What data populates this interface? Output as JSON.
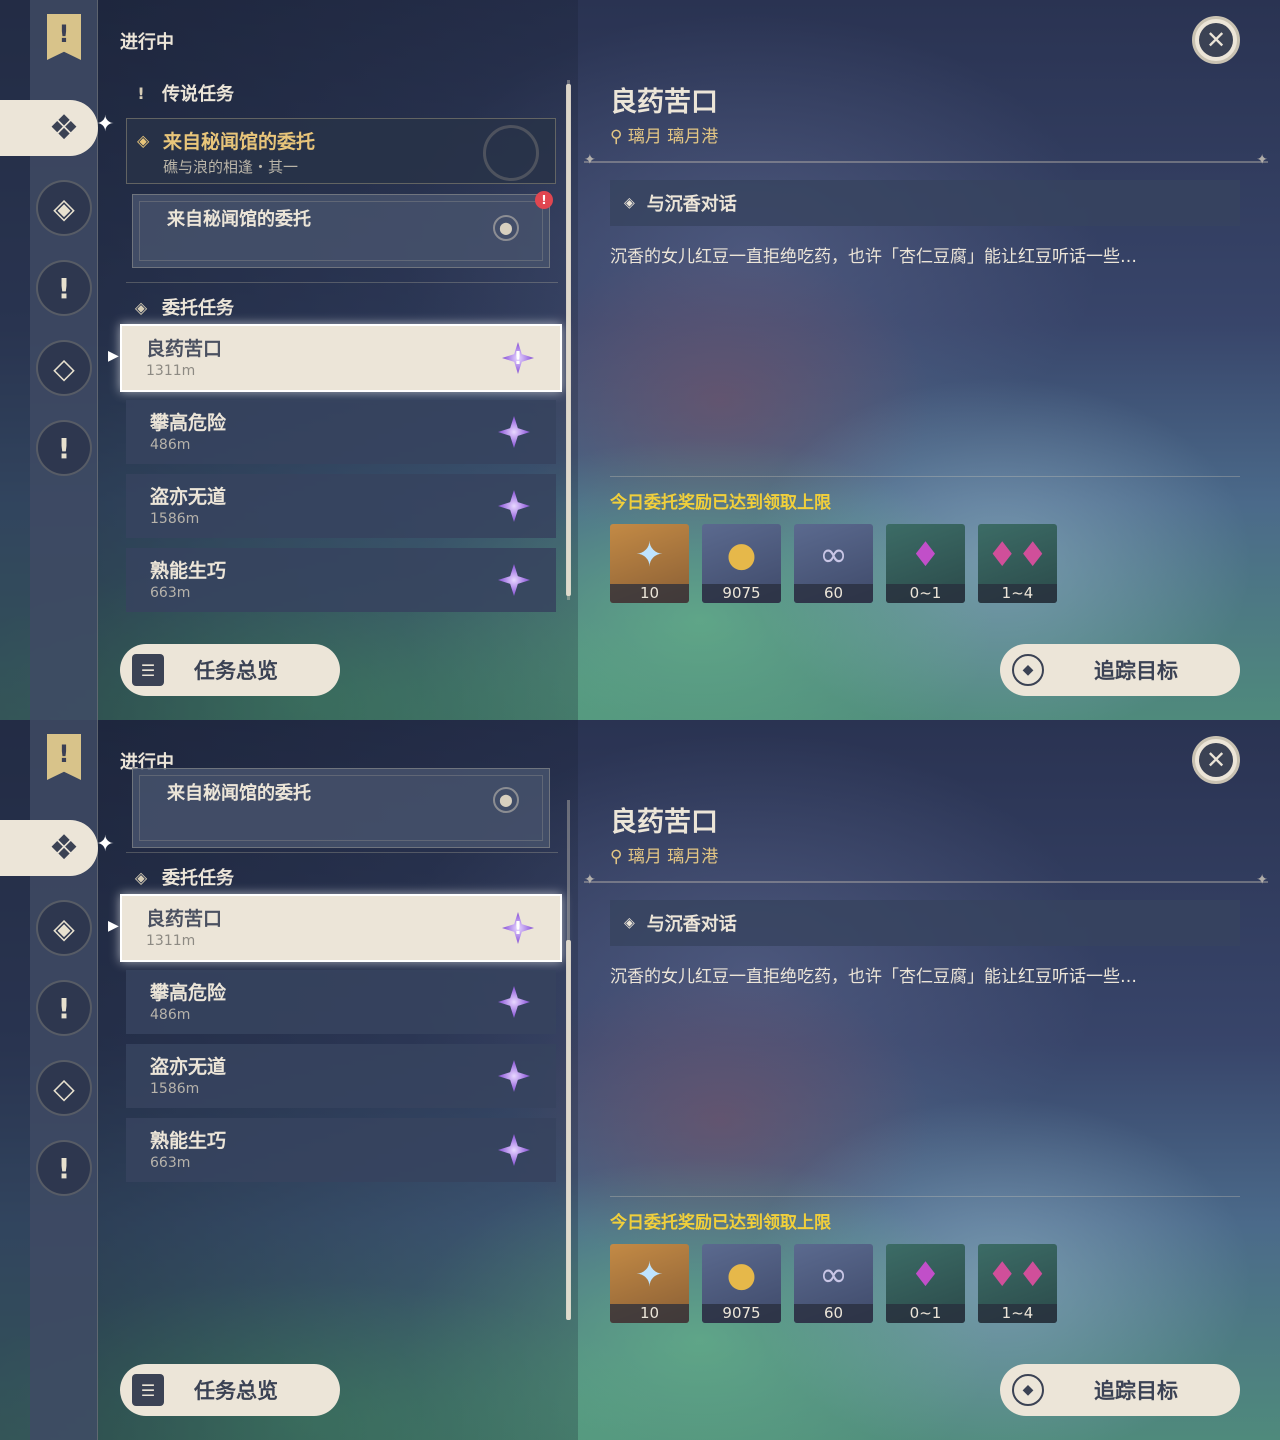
{
  "header": {
    "section_title": "进行中"
  },
  "sidebar": {
    "icons": [
      "banner-icon",
      "commission-icon",
      "archon-icon",
      "story-icon",
      "world-icon",
      "legend-icon"
    ]
  },
  "legend_group": {
    "label": "传说任务",
    "quest_title": "来自秘闻馆的委托",
    "quest_subtitle": "礁与浪的相逢・其一",
    "sub_objective": "来自秘闻馆的委托",
    "alert_mark": "!"
  },
  "commission_group": {
    "label": "委托任务",
    "items": [
      {
        "title": "良药苦口",
        "distance": "1311m"
      },
      {
        "title": "攀高危险",
        "distance": "486m"
      },
      {
        "title": "盗亦无道",
        "distance": "1586m"
      },
      {
        "title": "熟能生巧",
        "distance": "663m"
      }
    ]
  },
  "detail": {
    "title": "良药苦口",
    "location": "璃月 璃月港",
    "objective": "与沉香对话",
    "description": "沉香的女儿红豆一直拒绝吃药，也许「杏仁豆腐」能让红豆听话一些…",
    "reward_note": "今日委托奖励已达到领取上限",
    "rewards": [
      {
        "name": "primogem-icon",
        "count": "10"
      },
      {
        "name": "mora-icon",
        "count": "9075"
      },
      {
        "name": "exp-icon",
        "count": "60"
      },
      {
        "name": "crystal-icon",
        "count": "0~1"
      },
      {
        "name": "crystal-cluster-icon",
        "count": "1~4"
      }
    ]
  },
  "buttons": {
    "overview": "任务总览",
    "track": "追踪目标",
    "close": "✕"
  },
  "colors": {
    "panel_cream": "#ece5d8",
    "legend_gold": "#e8c57a",
    "reward_note_yellow": "#f1cf3b",
    "commission_purple": "#9a6ae0"
  }
}
